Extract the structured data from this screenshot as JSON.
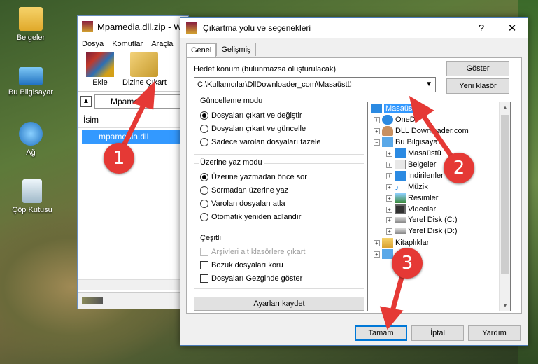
{
  "desktop": {
    "icons": [
      {
        "label": "Belgeler",
        "icon": "folder-icon"
      },
      {
        "label": "Bu Bilgisayar",
        "icon": "computer-icon"
      },
      {
        "label": "Ağ",
        "icon": "network-icon"
      },
      {
        "label": "Çöp Kutusu",
        "icon": "recycle-bin-icon"
      }
    ]
  },
  "winrar": {
    "title": "Mpamedia.dll.zip - W",
    "menu": [
      "Dosya",
      "Komutlar",
      "Araçla"
    ],
    "toolbar": {
      "add_label": "Ekle",
      "extract_label": "Dizine Çıkart"
    },
    "path": "Mpamedia",
    "column_header": "İsim",
    "file_row": "mpamedia.dll"
  },
  "dialog": {
    "title": "Çıkartma yolu ve seçenekleri",
    "help_button": "?",
    "close_button": "✕",
    "tabs": [
      "Genel",
      "Gelişmiş"
    ],
    "dest_label": "Hedef konum (bulunmazsa oluşturulacak)",
    "dest_value": "C:\\Kullanıcılar\\DllDownloader_com\\Masaüstü",
    "show_button": "Göster",
    "new_folder_button": "Yeni klasör",
    "update_mode": {
      "title": "Güncelleme modu",
      "options": [
        "Dosyaları çıkart ve değiştir",
        "Dosyaları çıkart ve güncelle",
        "Sadece varolan dosyaları tazele"
      ]
    },
    "overwrite_mode": {
      "title": "Üzerine yaz modu",
      "options": [
        "Üzerine yazmadan önce sor",
        "Sormadan üzerine yaz",
        "Varolan dosyaları atla",
        "Otomatik yeniden adlandır"
      ]
    },
    "misc": {
      "title": "Çeşitli",
      "options": [
        "Arşivleri alt klasörlere çıkart",
        "Bozuk dosyaları koru",
        "Dosyaları Gezginde göster"
      ]
    },
    "save_settings_button": "Ayarları kaydet",
    "tree": [
      "Masaüstü",
      "OneD",
      "DLL Downloader.com",
      "Bu Bilgisaya",
      "Masaüstü",
      "Belgeler",
      "İndirilenler",
      "Müzik",
      "Resimler",
      "Videolar",
      "Yerel Disk (C:)",
      "Yerel Disk (D:)",
      "Kitaplıklar"
    ],
    "ok_button": "Tamam",
    "cancel_button": "İptal",
    "help_bottom_button": "Yardım"
  },
  "annotations": {
    "step1": "1",
    "step2": "2",
    "step3": "3"
  }
}
